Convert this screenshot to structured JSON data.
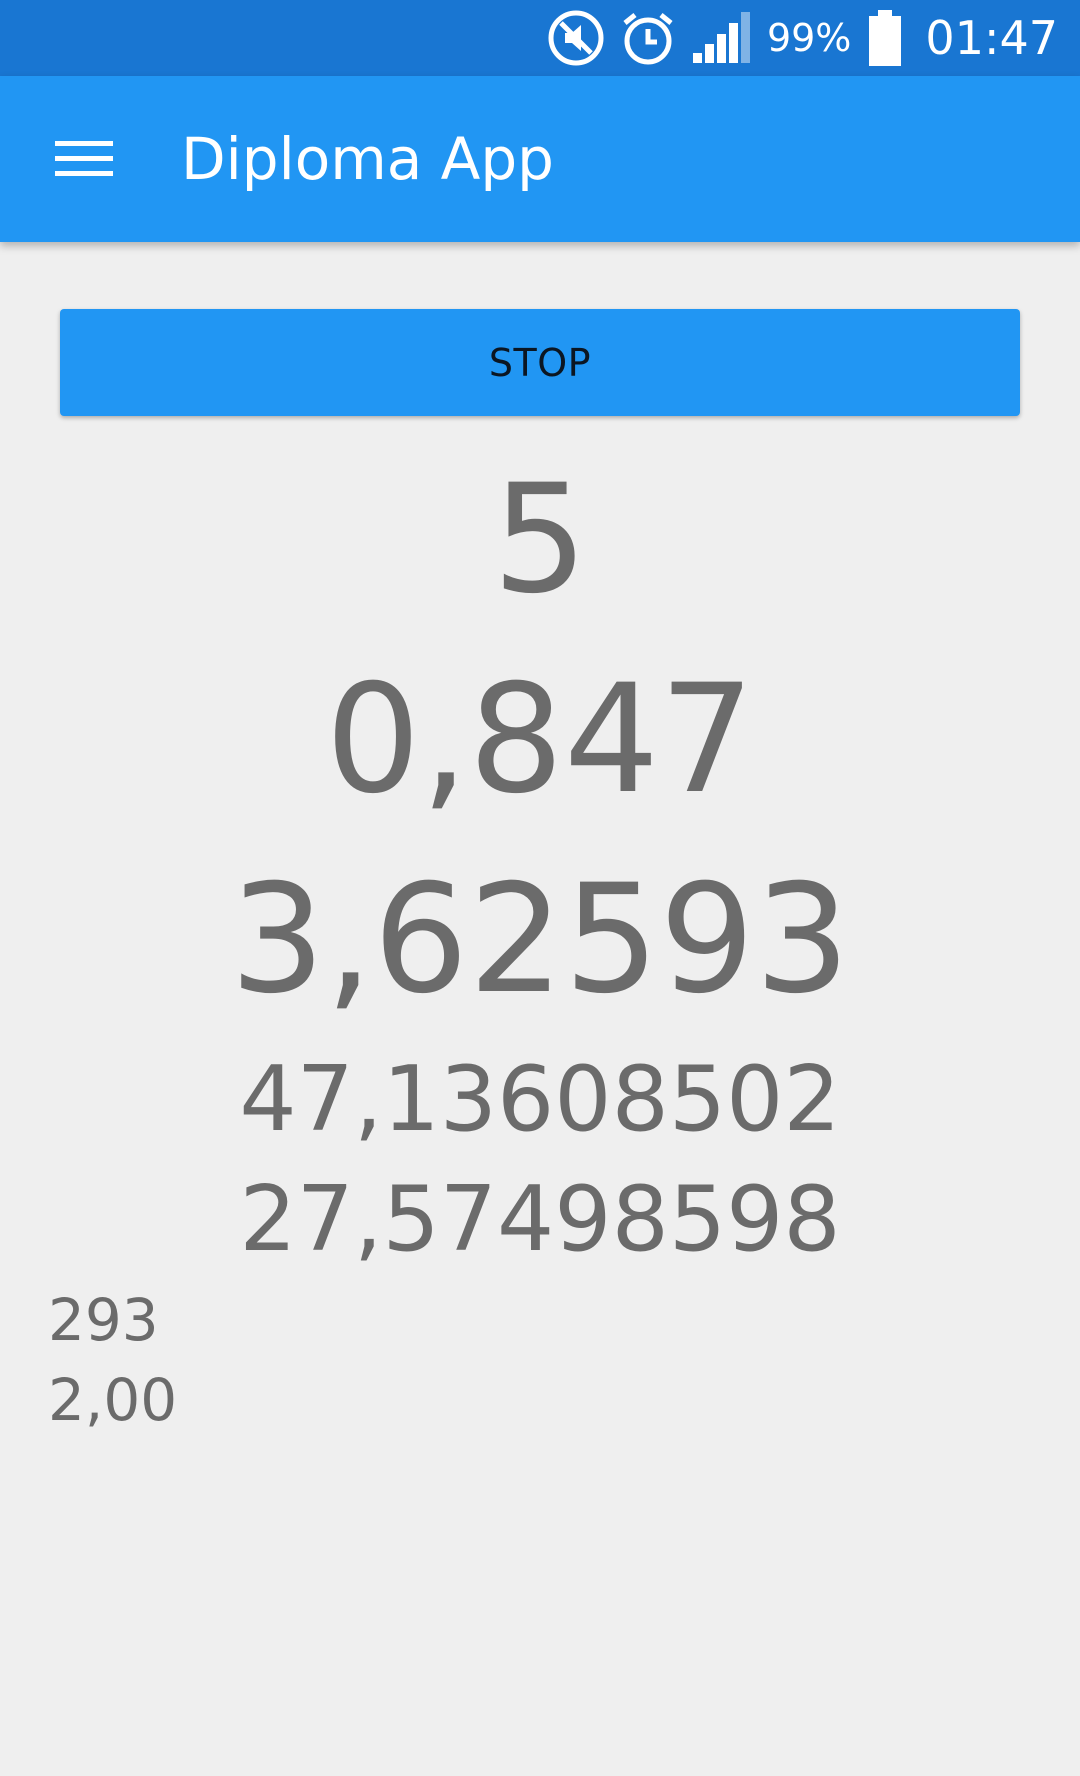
{
  "status_bar": {
    "battery_percent": "99%",
    "time": "01:47",
    "icons": [
      "mute-icon",
      "alarm-icon",
      "signal-icon",
      "battery-icon"
    ],
    "battery_level": 0.99,
    "background_color": "#1976d2"
  },
  "app_bar": {
    "title": "Diploma App",
    "menu_icon": "hamburger-menu-icon",
    "background_color": "#2196f3"
  },
  "main": {
    "stop_button_label": "STOP",
    "values": [
      "5",
      "0,847",
      "3,62593",
      "47,13608502",
      "27,57498598"
    ],
    "small_values": [
      "293",
      "2,00"
    ],
    "text_color": "#6b6b6b"
  }
}
